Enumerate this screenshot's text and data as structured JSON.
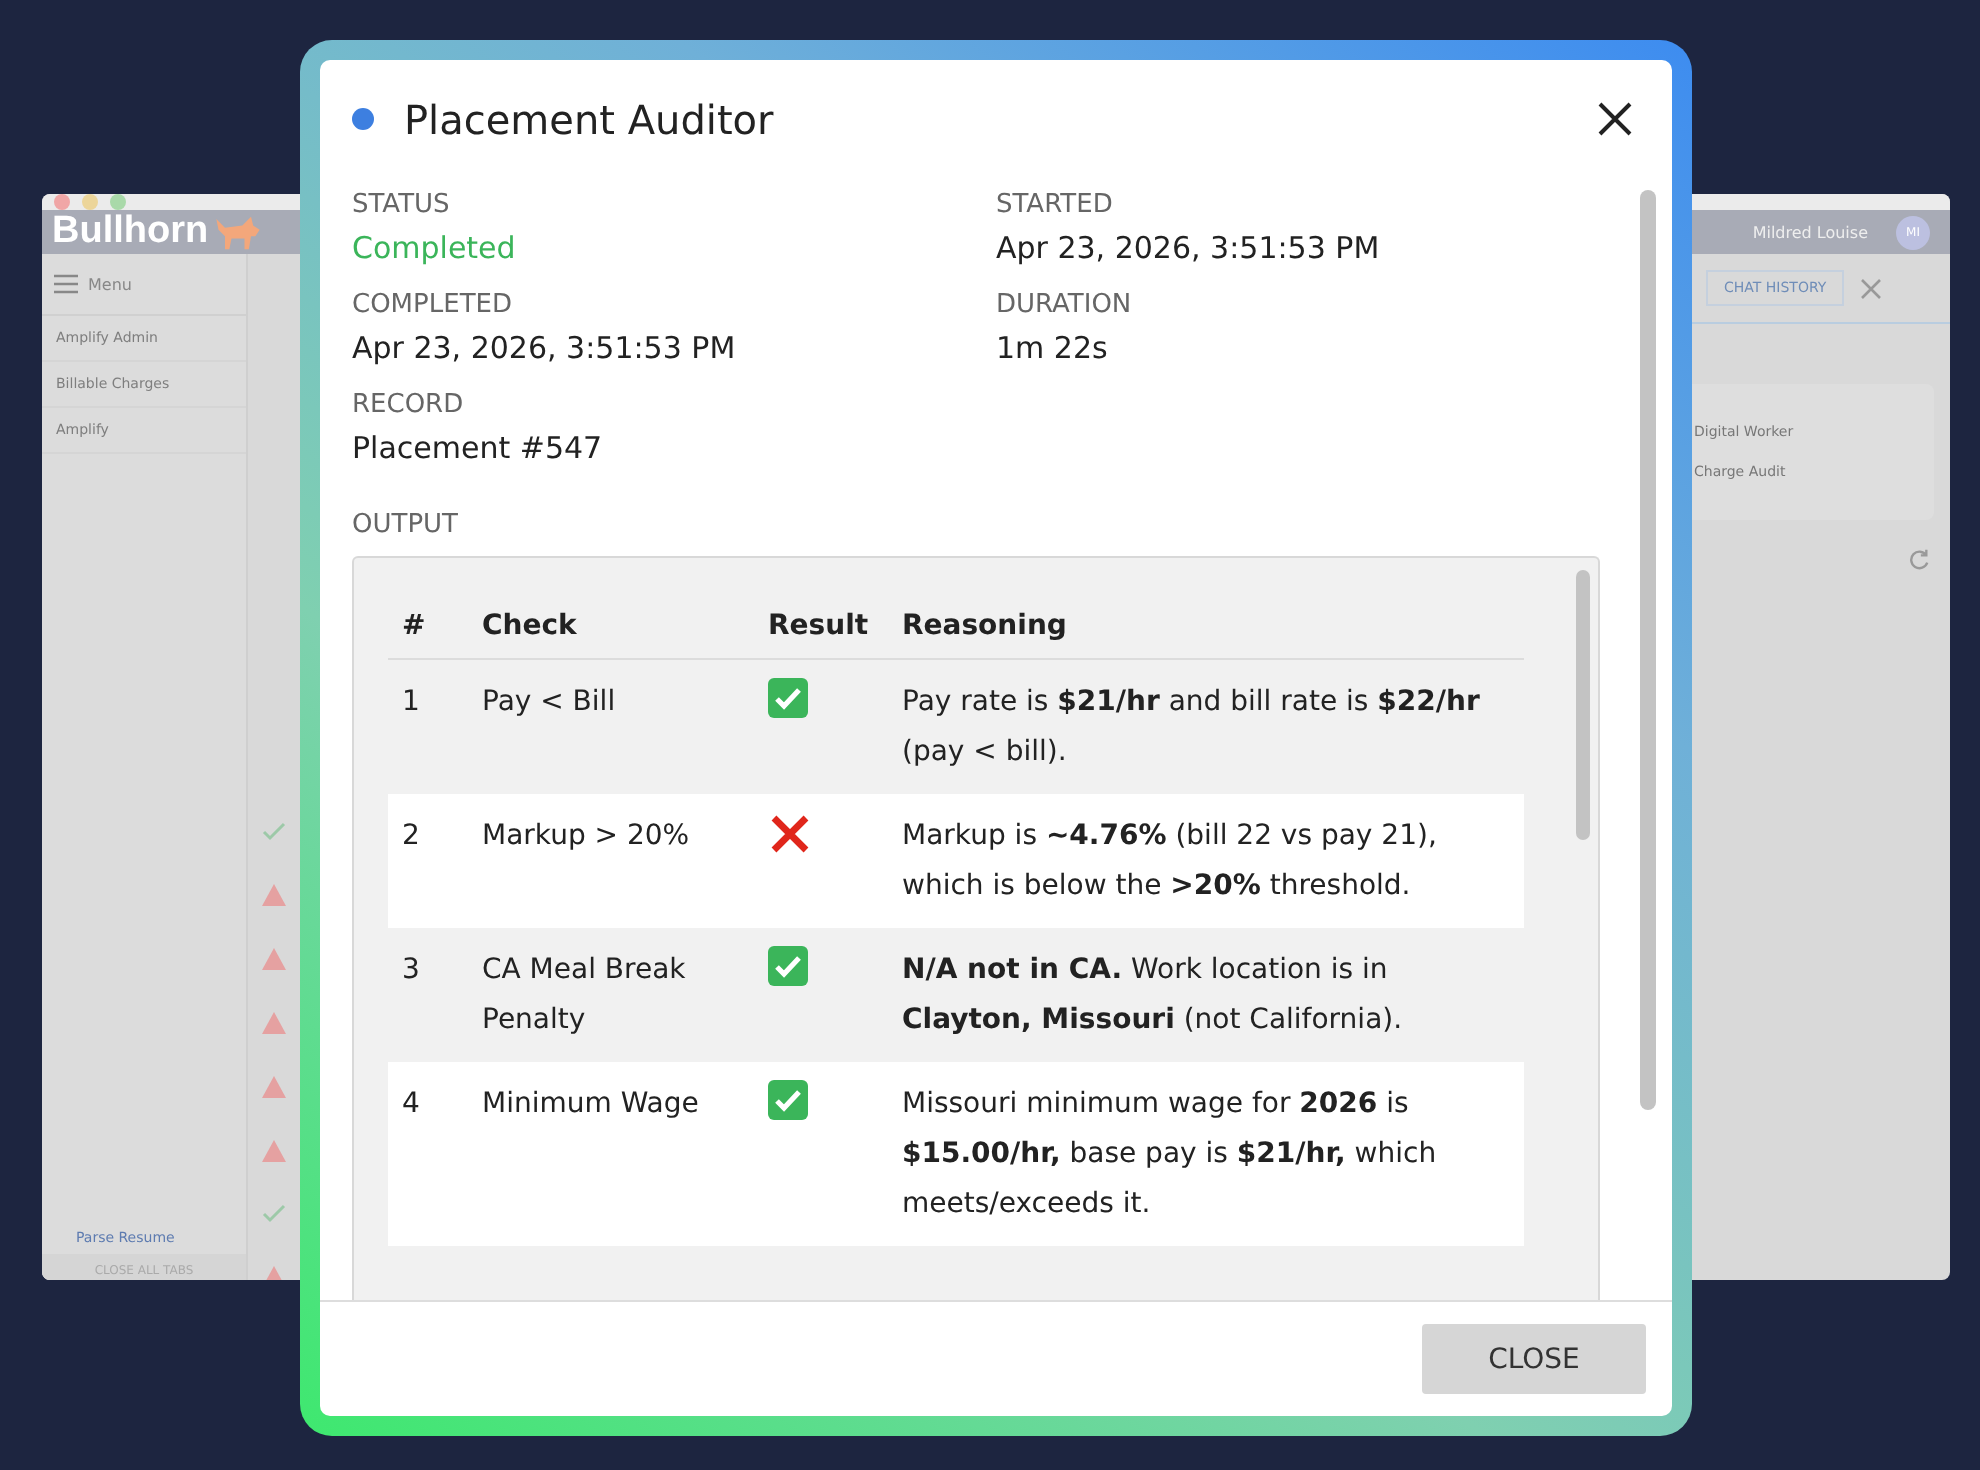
{
  "background_app": {
    "logo": "Bullhorn",
    "menu_label": "Menu",
    "sidebar_items": [
      {
        "label": "Amplify Admin"
      },
      {
        "label": "Billable Charges"
      },
      {
        "label": "Amplify"
      }
    ],
    "sidebar_footer": {
      "link": "Parse Resume",
      "button": "CLOSE ALL TABS"
    },
    "user": {
      "name": "Mildred Louise",
      "initials": "MI"
    },
    "chat_history_button": "CHAT HISTORY",
    "list_items": [
      "Digital Worker",
      "Charge Audit"
    ],
    "activity_icons": [
      {
        "kind": "check"
      },
      {
        "kind": "warning"
      },
      {
        "kind": "warning"
      },
      {
        "kind": "warning"
      },
      {
        "kind": "warning"
      },
      {
        "kind": "warning"
      },
      {
        "kind": "check"
      },
      {
        "kind": "warning"
      }
    ]
  },
  "dialog": {
    "title": "Placement Auditor",
    "fields": [
      {
        "label": "STATUS",
        "value": "Completed",
        "color": "#3bb55a"
      },
      {
        "label": "STARTED",
        "value": "Apr 23, 2026, 3:51:53 PM"
      },
      {
        "label": "COMPLETED",
        "value": "Apr 23, 2026, 3:51:53 PM"
      },
      {
        "label": "DURATION",
        "value": "1m 22s"
      },
      {
        "label": "RECORD",
        "value": "Placement #547"
      }
    ],
    "output_label": "OUTPUT",
    "table": {
      "columns": [
        "#",
        "Check",
        "Result",
        "Reasoning"
      ],
      "rows": [
        {
          "number": "1",
          "check": "Pay < Bill",
          "passed": true,
          "reasoning": "Pay rate is **$21/hr** and bill rate is **$22/hr** (pay < bill)."
        },
        {
          "number": "2",
          "check": "Markup > 20%",
          "passed": false,
          "reasoning": "Markup is **~4.76%** (bill 22 vs pay 21), which is below the **>20%** threshold."
        },
        {
          "number": "3",
          "check": "CA Meal Break Penalty",
          "passed": true,
          "reasoning": "**N/A not in CA.** Work location is in **Clayton, Missouri** (not California)."
        },
        {
          "number": "4",
          "check": "Minimum Wage",
          "passed": true,
          "reasoning": "Missouri minimum wage for **2026** is **$15.00/hr,** base pay is **$21/hr,** which meets/exceeds it."
        }
      ]
    },
    "close_button": "CLOSE"
  }
}
